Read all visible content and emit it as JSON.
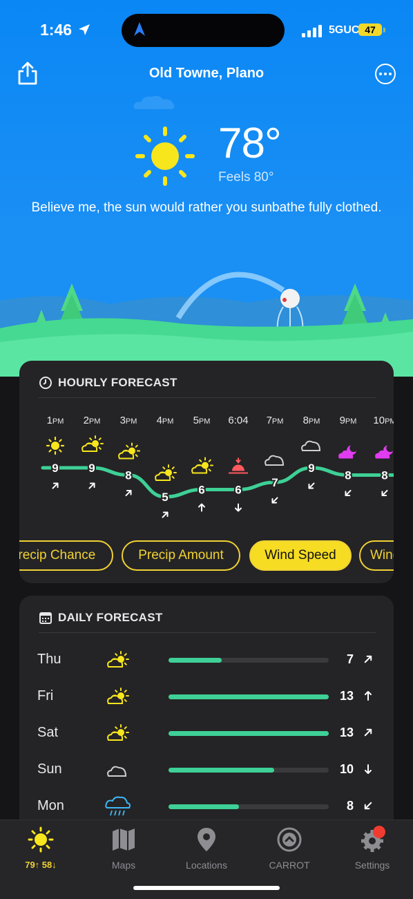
{
  "status_bar": {
    "time": "1:46",
    "network": "5GUC",
    "battery": "47"
  },
  "header": {
    "location": "Old Towne, Plano"
  },
  "current": {
    "temperature": "78°",
    "feels_like": "Feels 80°",
    "quote": "Believe me, the sun would rather you sunbathe fully clothed."
  },
  "hourly": {
    "title": "HOURLY FORECAST",
    "hours": [
      {
        "label": "1",
        "unit": "PM",
        "value": "9",
        "icon": "sun-icon"
      },
      {
        "label": "2",
        "unit": "PM",
        "value": "9",
        "icon": "partly-cloudy-icon"
      },
      {
        "label": "3",
        "unit": "PM",
        "value": "8",
        "icon": "partly-cloudy-icon"
      },
      {
        "label": "4",
        "unit": "PM",
        "value": "5",
        "icon": "partly-cloudy-icon"
      },
      {
        "label": "5",
        "unit": "PM",
        "value": "6",
        "icon": "partly-cloudy-icon"
      },
      {
        "label": "6:04",
        "unit": "",
        "value": "6",
        "icon": "sunset-icon"
      },
      {
        "label": "7",
        "unit": "PM",
        "value": "7",
        "icon": "cloud-icon"
      },
      {
        "label": "8",
        "unit": "PM",
        "value": "9",
        "icon": "cloud-icon"
      },
      {
        "label": "9",
        "unit": "PM",
        "value": "8",
        "icon": "partly-cloudy-night-icon"
      },
      {
        "label": "10",
        "unit": "PM",
        "value": "8",
        "icon": "partly-cloudy-night-icon"
      }
    ],
    "pills": [
      "Precip Chance",
      "Precip Amount",
      "Wind Speed",
      "Wind"
    ],
    "active_pill": "Wind Speed"
  },
  "daily": {
    "title": "DAILY FORECAST",
    "days": [
      {
        "day": "Thu",
        "value": "7",
        "fill": 0.33,
        "icon": "partly-cloudy-icon",
        "direction": "northeast"
      },
      {
        "day": "Fri",
        "value": "13",
        "fill": 1.0,
        "icon": "partly-cloudy-icon",
        "direction": "north"
      },
      {
        "day": "Sat",
        "value": "13",
        "fill": 1.0,
        "icon": "partly-cloudy-icon",
        "direction": "northeast"
      },
      {
        "day": "Sun",
        "value": "10",
        "fill": 0.66,
        "icon": "cloud-icon",
        "direction": "south"
      },
      {
        "day": "Mon",
        "value": "8",
        "fill": 0.44,
        "icon": "rain-icon",
        "direction": "southwest"
      }
    ]
  },
  "tabbar": {
    "today": "79↑ 58↓",
    "maps": "Maps",
    "locations": "Locations",
    "carrot": "CARROT",
    "settings": "Settings"
  },
  "colors": {
    "accent": "#f6dc23",
    "wind_line": "#3ed096",
    "sky": "#1a8ff4"
  }
}
